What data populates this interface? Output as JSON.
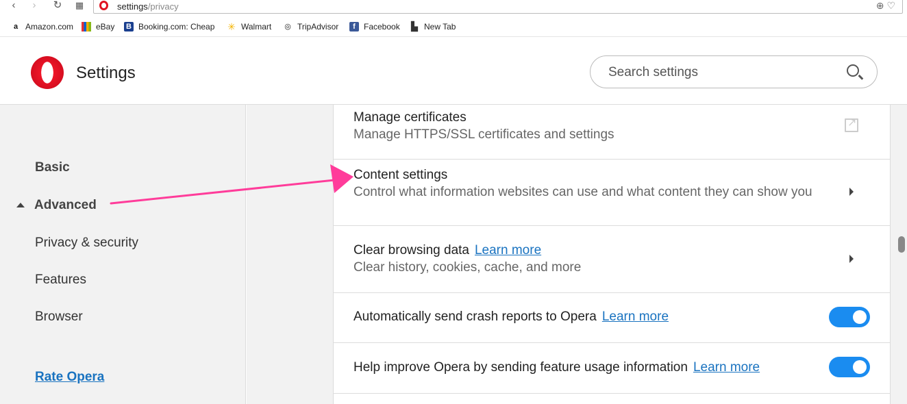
{
  "address": {
    "host": "settings",
    "path": "/privacy"
  },
  "bookmarks": [
    {
      "label": "Amazon.com",
      "icon": "amazon-icon"
    },
    {
      "label": "eBay",
      "icon": "ebay-icon"
    },
    {
      "label": "Booking.com: Cheap",
      "icon": "booking-icon"
    },
    {
      "label": "Walmart",
      "icon": "walmart-icon"
    },
    {
      "label": "TripAdvisor",
      "icon": "tripadvisor-icon"
    },
    {
      "label": "Facebook",
      "icon": "facebook-icon"
    },
    {
      "label": "New Tab",
      "icon": "page-icon"
    }
  ],
  "header": {
    "title": "Settings",
    "search_placeholder": "Search settings"
  },
  "sidebar": {
    "items": [
      {
        "label": "Basic"
      },
      {
        "label": "Advanced"
      },
      {
        "label": "Privacy & security"
      },
      {
        "label": "Features"
      },
      {
        "label": "Browser"
      }
    ],
    "rate_link": "Rate Opera"
  },
  "rows": [
    {
      "title": "Manage certificates",
      "subtitle": "Manage HTTPS/SSL certificates and settings"
    },
    {
      "title": "Content settings",
      "subtitle": "Control what information websites can use and what content they can show you"
    },
    {
      "title": "Clear browsing data",
      "learn_more": "Learn more",
      "subtitle": "Clear history, cookies, cache, and more"
    },
    {
      "title": "Automatically send crash reports to Opera",
      "learn_more": "Learn more",
      "enabled": true
    },
    {
      "title": "Help improve Opera by sending feature usage information",
      "learn_more": "Learn more",
      "enabled": true
    }
  ],
  "colors": {
    "accent": "#1a8cf0",
    "link": "#1a73c0",
    "opera_red": "#e01422",
    "annotation_arrow": "#ff3c9a"
  }
}
